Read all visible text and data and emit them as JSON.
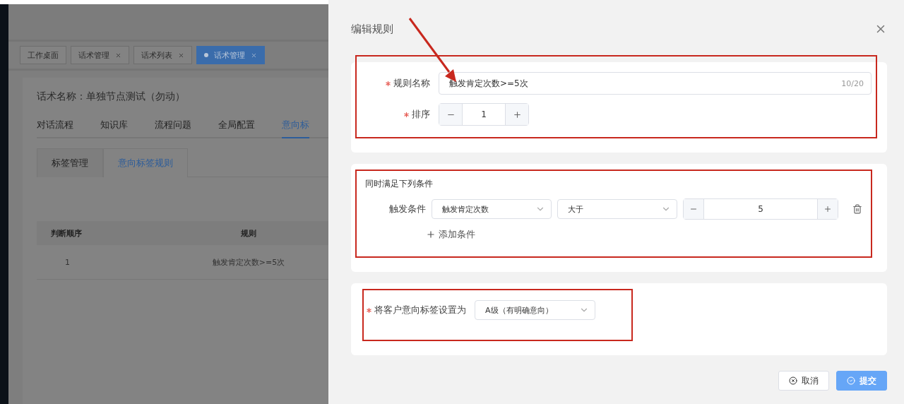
{
  "background_page": {
    "tabs": [
      {
        "label": "工作桌面",
        "closable": false,
        "selected": false
      },
      {
        "label": "话术管理",
        "closable": true,
        "selected": false
      },
      {
        "label": "话术列表",
        "closable": true,
        "selected": false
      },
      {
        "label": "话术管理",
        "closable": true,
        "selected": true
      }
    ],
    "script_name": "话术名称：单独节点测试（勿动）",
    "nav_tabs": [
      {
        "label": "对话流程",
        "selected": false
      },
      {
        "label": "知识库",
        "selected": false
      },
      {
        "label": "流程问题",
        "selected": false
      },
      {
        "label": "全局配置",
        "selected": false
      },
      {
        "label": "意向标",
        "selected": true
      }
    ],
    "sub_tabs": [
      {
        "label": "标签管理",
        "selected": false
      },
      {
        "label": "意向标签规则",
        "selected": true
      }
    ],
    "table": {
      "columns": [
        "判断顺序",
        "规则"
      ],
      "rows": [
        [
          "1",
          "触发肯定次数>=5次"
        ]
      ]
    }
  },
  "dialog": {
    "title": "编辑规则",
    "rule_name": {
      "label": "规则名称",
      "required": true,
      "value": "触发肯定次数>=5次",
      "counter": "10/20"
    },
    "order": {
      "label": "排序",
      "required": true,
      "value": "1"
    },
    "conditions": {
      "heading": "同时满足下列条件",
      "label": "触发条件",
      "rows": [
        {
          "field": "触发肯定次数",
          "operator": "大于",
          "value": "5"
        }
      ],
      "add_button": "添加条件"
    },
    "intent_tag": {
      "label": "将客户意向标签设置为",
      "required": true,
      "value": "A级（有明确意向）"
    },
    "buttons": [
      {
        "label": "取消",
        "kind": "secondary"
      },
      {
        "label": "提交",
        "kind": "primary"
      }
    ]
  }
}
